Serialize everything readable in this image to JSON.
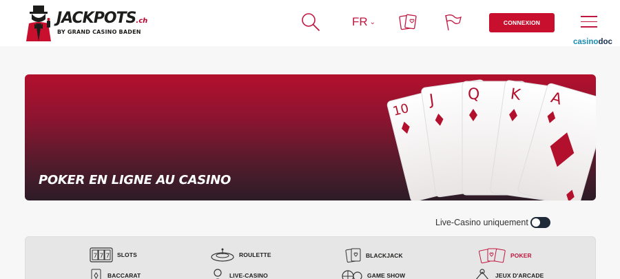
{
  "header": {
    "logo": {
      "brand": "JACKPOTS",
      "suffix": ".ch",
      "tagline": "BY GRAND CASINO BADEN"
    },
    "language": "FR",
    "login_label": "CONNEXION",
    "partner_badge": {
      "part1": "casino",
      "part2": "doc"
    }
  },
  "banner": {
    "title": "POKER EN LIGNE AU CASINO"
  },
  "filter": {
    "live_casino_label": "Live-Casino uniquement",
    "live_casino_enabled": false
  },
  "categories": [
    {
      "label": "SLOTS",
      "icon": "slot-machine-icon",
      "active": false
    },
    {
      "label": "ROULETTE",
      "icon": "roulette-icon",
      "active": false
    },
    {
      "label": "BLACKJACK",
      "icon": "blackjack-cards-icon",
      "active": false
    },
    {
      "label": "POKER",
      "icon": "poker-cards-icon",
      "active": true
    },
    {
      "label": "BACCARAT",
      "icon": "baccarat-icon",
      "active": false
    },
    {
      "label": "LIVE-CASINO",
      "icon": "live-dealer-icon",
      "active": false
    },
    {
      "label": "GAME SHOW",
      "icon": "game-show-icon",
      "active": false
    },
    {
      "label": "JEUX D'ARCADE",
      "icon": "arcade-icon",
      "active": false
    }
  ],
  "colors": {
    "accent": "#c8102e",
    "dark": "#1e2a38"
  }
}
